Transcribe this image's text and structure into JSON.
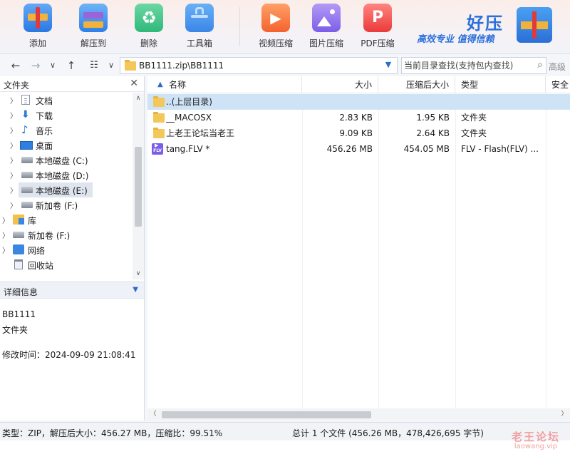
{
  "toolbar": {
    "buttons": [
      {
        "label": "添加",
        "icon": "add-archive-icon"
      },
      {
        "label": "解压到",
        "icon": "extract-icon"
      },
      {
        "label": "删除",
        "icon": "recycle-icon"
      },
      {
        "label": "工具箱",
        "icon": "toolbox-icon"
      },
      {
        "label": "视频压缩",
        "icon": "video-compress-icon"
      },
      {
        "label": "图片压缩",
        "icon": "image-compress-icon"
      },
      {
        "label": "PDF压缩",
        "icon": "pdf-compress-icon"
      }
    ],
    "brand": {
      "title": "好压",
      "slogan": "高效专业  值得信赖"
    }
  },
  "nav": {
    "path": "BB1111.zip\\BB1111",
    "search_placeholder": "当前目录查找(支持包内查找)",
    "advanced": "高级"
  },
  "left_panel": {
    "title": "文件夹",
    "tree": [
      {
        "label": "文档",
        "icon": "document-icon",
        "level": 1
      },
      {
        "label": "下载",
        "icon": "download-icon",
        "level": 1
      },
      {
        "label": "音乐",
        "icon": "music-icon",
        "level": 1
      },
      {
        "label": "桌面",
        "icon": "desktop-icon",
        "level": 1
      },
      {
        "label": "本地磁盘 (C:)",
        "icon": "drive-icon",
        "level": 1
      },
      {
        "label": "本地磁盘 (D:)",
        "icon": "drive-icon",
        "level": 1
      },
      {
        "label": "本地磁盘 (E:)",
        "icon": "drive-icon",
        "level": 1,
        "selected": true
      },
      {
        "label": "新加卷 (F:)",
        "icon": "drive-icon",
        "level": 1
      },
      {
        "label": "库",
        "icon": "library-icon",
        "level": 0
      },
      {
        "label": "新加卷 (F:)",
        "icon": "drive-icon",
        "level": 0
      },
      {
        "label": "网络",
        "icon": "network-icon",
        "level": 0
      },
      {
        "label": "回收站",
        "icon": "recycle-bin-icon",
        "level": 0,
        "no_expander": true
      }
    ],
    "detail": {
      "title": "详细信息",
      "name": "BB1111",
      "type": "文件夹",
      "modified": "修改时间：2024-09-09 21:08:41"
    }
  },
  "file_list": {
    "columns": [
      "名称",
      "大小",
      "压缩后大小",
      "类型",
      "安全"
    ],
    "rows": [
      {
        "name": "..(上层目录)",
        "size": "",
        "packed": "",
        "type": "",
        "icon": "folder-icon",
        "selected": true
      },
      {
        "name": "__MACOSX",
        "size": "2.83 KB",
        "packed": "1.95 KB",
        "type": "文件夹",
        "icon": "folder-icon"
      },
      {
        "name": "上老王论坛当老王",
        "size": "9.09 KB",
        "packed": "2.64 KB",
        "type": "文件夹",
        "icon": "folder-icon"
      },
      {
        "name": "tang.FLV *",
        "size": "456.26 MB",
        "packed": "454.05 MB",
        "type": "FLV - Flash(FLV) ...",
        "icon": "flv-file-icon"
      }
    ],
    "flv_badge": "FLV"
  },
  "status": {
    "left": "类型：ZIP，解压后大小：456.27 MB，压缩比：99.51%",
    "right": "总计 1 个文件 (456.26 MB，478,426,695 字节)"
  },
  "watermark": {
    "line1": "老王论坛",
    "line2": "laowang.vip"
  }
}
